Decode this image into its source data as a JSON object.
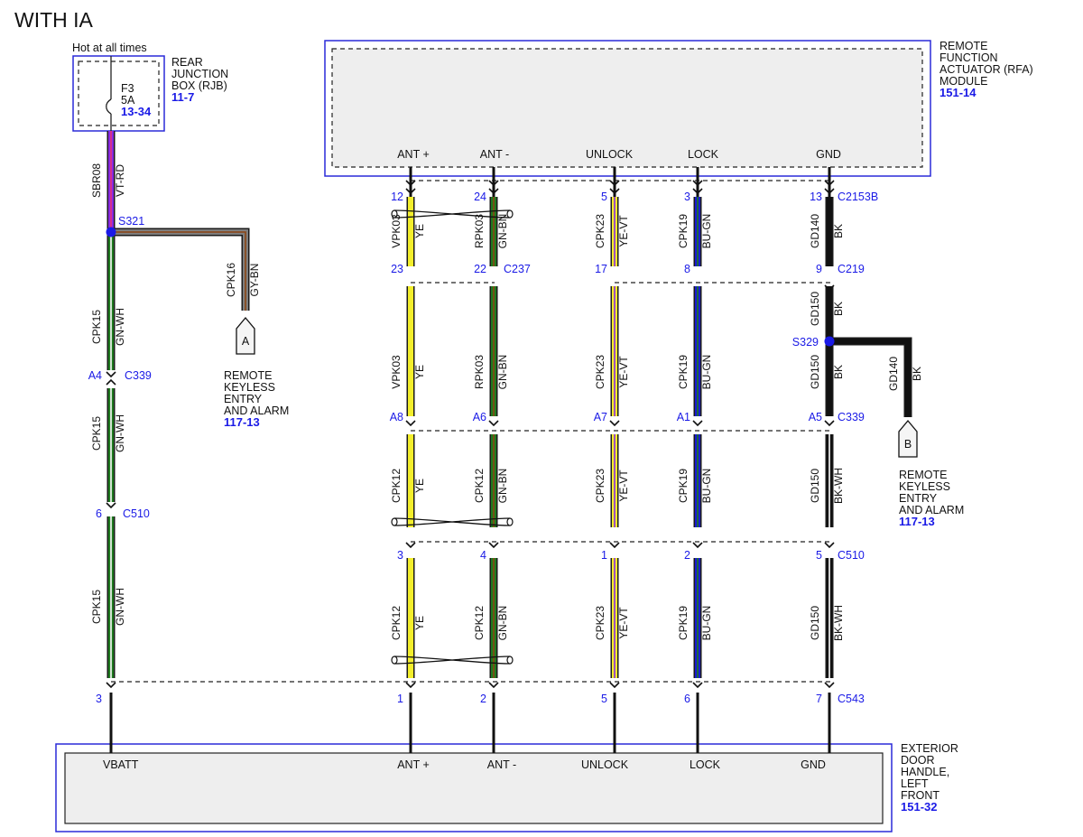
{
  "title": "WITH IA",
  "colors": {
    "YE": "#f3ee2c",
    "GN": "#1f7a1f",
    "BU": "#1a1ad0",
    "BK": "#111111",
    "VT": "#8a2be2",
    "RD": "#e8307a",
    "WH": "#ffffff",
    "GY": "#7d7d7d",
    "BN": "#8b4513",
    "pin_text": "#1a1ae6",
    "box_border": "#2a2ad8"
  },
  "rjb": {
    "hot_label": "Hot at all times",
    "name_lines": [
      "REAR",
      "JUNCTION",
      "BOX (RJB)"
    ],
    "ref": "11-7",
    "fuse_name": "F3",
    "fuse_rating": "5A",
    "fuse_ref": "13-34"
  },
  "rfa": {
    "name_lines": [
      "REMOTE",
      "FUNCTION",
      "ACTUATOR (RFA)",
      "MODULE"
    ],
    "ref": "151-14",
    "pins": [
      "ANT +",
      "ANT -",
      "UNLOCK",
      "LOCK",
      "GND"
    ]
  },
  "door": {
    "name_lines": [
      "EXTERIOR",
      "DOOR",
      "HANDLE,",
      "LEFT",
      "FRONT"
    ],
    "ref": "151-32",
    "pins": [
      "VBATT",
      "ANT +",
      "ANT -",
      "UNLOCK",
      "LOCK",
      "GND"
    ]
  },
  "connectors": {
    "c2153b": "C2153B",
    "c237": "C237",
    "c219": "C219",
    "c339": "C339",
    "c510": "C510",
    "c543": "C543"
  },
  "splices": {
    "s321": "S321",
    "s329": "S329"
  },
  "power_circuit": {
    "seg1": {
      "circuit": "SBR08",
      "color": "VT-RD"
    },
    "seg2": {
      "circuit": "CPK15",
      "color": "GN-WH"
    },
    "seg3": {
      "circuit": "CPK15",
      "color": "GN-WH"
    },
    "seg4": {
      "circuit": "CPK15",
      "color": "GN-WH"
    },
    "pins": {
      "c339": "A4",
      "c510": "6",
      "c543": "3"
    }
  },
  "branch_a": {
    "circuit": "CPK16",
    "color": "GY-BN",
    "letter": "A",
    "dest_lines": [
      "REMOTE",
      "KEYLESS",
      "ENTRY",
      "AND ALARM"
    ],
    "ref": "117-13"
  },
  "branch_b": {
    "circuit": "GD140",
    "color": "BK",
    "letter": "B",
    "dest_lines": [
      "REMOTE",
      "KEYLESS",
      "ENTRY",
      "AND ALARM"
    ],
    "ref": "117-13"
  },
  "wires": [
    {
      "id": "ant-plus",
      "pins": {
        "c2153b": "12",
        "c237": "23",
        "c339": "A8",
        "c510": "3",
        "c543": "1"
      },
      "segs": [
        {
          "circuit": "VPK03",
          "color": "YE"
        },
        {
          "circuit": "VPK03",
          "color": "YE"
        },
        {
          "circuit": "CPK12",
          "color": "YE"
        },
        {
          "circuit": "CPK12",
          "color": "YE"
        }
      ]
    },
    {
      "id": "ant-minus",
      "pins": {
        "c2153b": "24",
        "c237": "22",
        "c339": "A6",
        "c510": "4",
        "c543": "2"
      },
      "segs": [
        {
          "circuit": "RPK03",
          "color": "GN-BN"
        },
        {
          "circuit": "RPK03",
          "color": "GN-BN"
        },
        {
          "circuit": "CPK12",
          "color": "GN-BN"
        },
        {
          "circuit": "CPK12",
          "color": "GN-BN"
        }
      ]
    },
    {
      "id": "unlock",
      "pins": {
        "c2153b": "5",
        "c237": "17",
        "c339": "A7",
        "c510": "1",
        "c543": "5"
      },
      "segs": [
        {
          "circuit": "CPK23",
          "color": "YE-VT"
        },
        {
          "circuit": "CPK23",
          "color": "YE-VT"
        },
        {
          "circuit": "CPK23",
          "color": "YE-VT"
        },
        {
          "circuit": "CPK23",
          "color": "YE-VT"
        }
      ]
    },
    {
      "id": "lock",
      "pins": {
        "c2153b": "3",
        "c237": "8",
        "c339": "A1",
        "c510": "2",
        "c543": "6"
      },
      "segs": [
        {
          "circuit": "CPK19",
          "color": "BU-GN"
        },
        {
          "circuit": "CPK19",
          "color": "BU-GN"
        },
        {
          "circuit": "CPK19",
          "color": "BU-GN"
        },
        {
          "circuit": "CPK19",
          "color": "BU-GN"
        }
      ]
    },
    {
      "id": "gnd",
      "pins": {
        "c2153b": "13",
        "c219": "9",
        "c339": "A5",
        "c510": "5",
        "c543": "7"
      },
      "segs": [
        {
          "circuit": "GD140",
          "color": "BK"
        },
        {
          "circuit": "GD150",
          "color": "BK"
        },
        {
          "circuit": "GD150",
          "color": "BK"
        },
        {
          "circuit": "GD150",
          "color": "BK-WH"
        },
        {
          "circuit": "GD150",
          "color": "BK-WH"
        }
      ]
    }
  ]
}
